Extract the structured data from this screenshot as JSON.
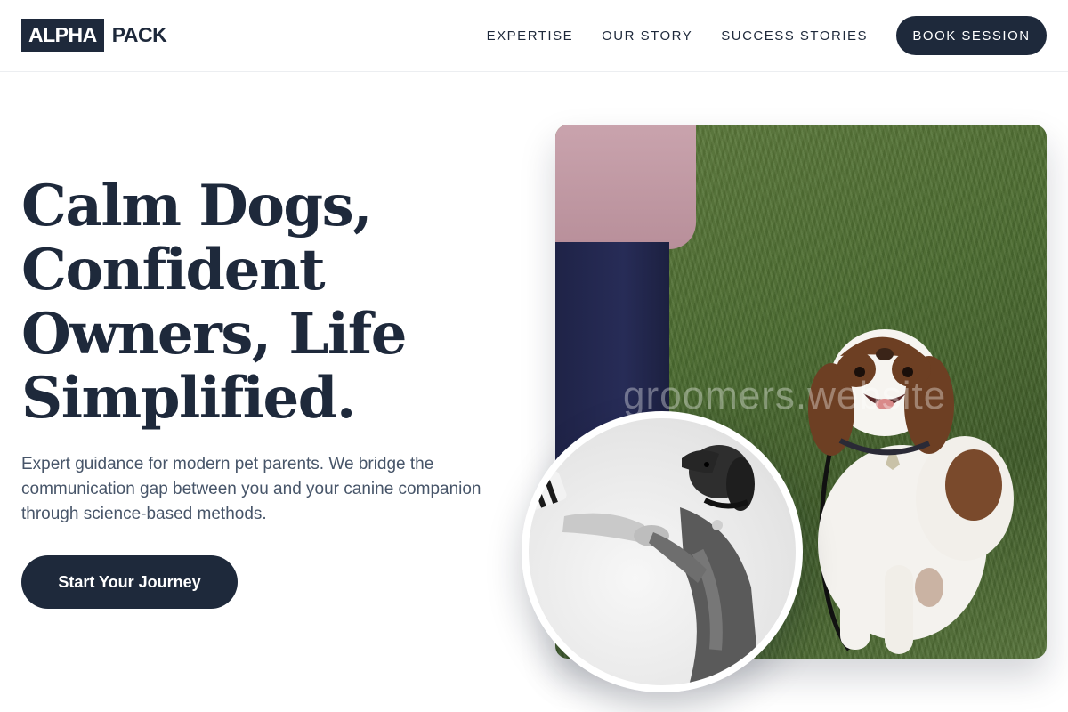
{
  "brand": {
    "logo_box": "ALPHA",
    "logo_text": "PACK"
  },
  "nav": {
    "items": [
      {
        "label": "EXPERTISE"
      },
      {
        "label": "OUR STORY"
      },
      {
        "label": "SUCCESS STORIES"
      }
    ],
    "cta_label": "BOOK SESSION"
  },
  "hero": {
    "headline_lines": [
      "Calm Dogs,",
      "Confident",
      "Owners, Life",
      "Simplified."
    ],
    "subtext": "Expert guidance for modern pet parents. We bridge the communication gap between you and your canine companion through science-based methods.",
    "cta_label": "Start Your Journey"
  },
  "images": {
    "main_photo_watermark": "groomers.website"
  },
  "colors": {
    "primary": "#1e293b",
    "body_text": "#475569",
    "background": "#ffffff"
  }
}
